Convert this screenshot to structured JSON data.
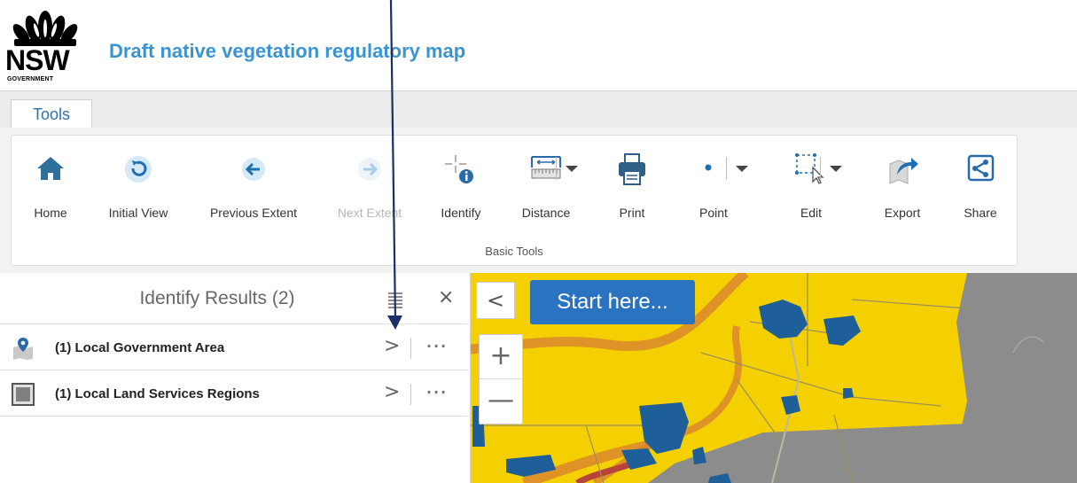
{
  "header": {
    "logo_word": "NSW",
    "logo_sub": "GOVERNMENT",
    "title": "Draft native vegetation regulatory map"
  },
  "tabs": [
    {
      "label": "Tools",
      "active": true
    }
  ],
  "ribbon": {
    "group_label": "Basic Tools",
    "buttons": [
      {
        "label": "Home",
        "icon": "home-icon",
        "enabled": true
      },
      {
        "label": "Initial View",
        "icon": "initial-view-icon",
        "enabled": true
      },
      {
        "label": "Previous Extent",
        "icon": "previous-extent-icon",
        "enabled": true
      },
      {
        "label": "Next Extent",
        "icon": "next-extent-icon",
        "enabled": false
      },
      {
        "label": "Identify",
        "icon": "identify-icon",
        "enabled": true
      },
      {
        "label": "Distance",
        "icon": "distance-icon",
        "enabled": true,
        "dropdown": true
      },
      {
        "label": "Print",
        "icon": "print-icon",
        "enabled": true
      },
      {
        "label": "Point",
        "icon": "point-icon",
        "enabled": true,
        "dropdown": true
      },
      {
        "label": "Edit",
        "icon": "edit-icon",
        "enabled": true,
        "dropdown": true
      },
      {
        "label": "Export",
        "icon": "export-icon",
        "enabled": true
      },
      {
        "label": "Share",
        "icon": "share-icon",
        "enabled": true
      }
    ]
  },
  "identify_panel": {
    "title": "Identify Results (2)",
    "results": [
      {
        "label": "(1) Local Government Area",
        "icon": "map-pin-icon"
      },
      {
        "label": "(1) Local Land Services Regions",
        "icon": "grey-square-icon"
      }
    ]
  },
  "map": {
    "collapse_glyph": "<",
    "start_button": "Start here...",
    "zoom_in": "+",
    "zoom_out": "—"
  },
  "colors": {
    "title_blue": "#3a94d0",
    "tab_blue": "#2f71a8",
    "start_button": "#2a73c0",
    "map_yellow": "#f5d000",
    "map_grey": "#8c8c8c",
    "vegetation_blue": "#1f5f99",
    "river_orange": "#e08a2e"
  }
}
